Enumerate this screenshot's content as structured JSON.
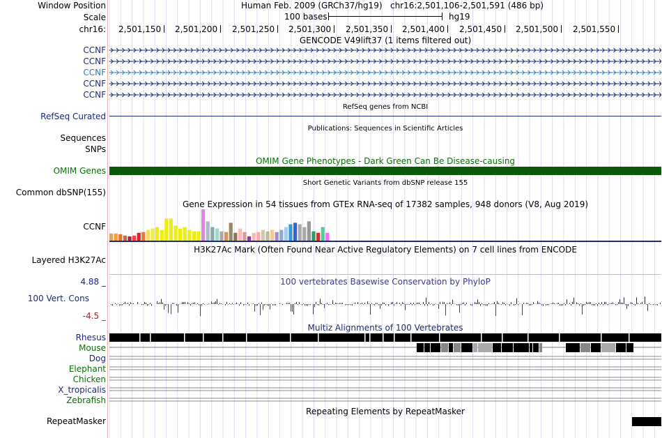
{
  "header": {
    "window_position_label": "Window Position",
    "assembly": "Human Feb. 2009 (GRCh37/hg19)",
    "position": "chr16:2,501,106-2,501,591 (486 bp)",
    "scale_label": "Scale",
    "scale_text": "100 bases",
    "db": "hg19",
    "chrom_label": "chr16:",
    "ticks": [
      "2,501,150",
      "2,501,200",
      "2,501,250",
      "2,501,300",
      "2,501,350",
      "2,501,400",
      "2,501,450",
      "2,501,500",
      "2,501,550"
    ]
  },
  "tracks": {
    "gencode": {
      "title": "GENCODE V49lift37 (1 items filtered out)",
      "genes": [
        "CCNF",
        "CCNF",
        "CCNF",
        "CCNF",
        "CCNF"
      ],
      "colors": {
        "main": "#1c2a78",
        "highlight": "#2a7fb5"
      }
    },
    "refseq": {
      "label": "RefSeq Curated",
      "title": "RefSeq genes from NCBI"
    },
    "publications": {
      "title": "Publications: Sequences in Scientific Articles",
      "label_sequences": "Sequences",
      "label_snps": "SNPs"
    },
    "omim": {
      "title": "OMIM Gene Phenotypes - Dark Green Can Be Disease-causing",
      "label": "OMIM Genes",
      "color": "#0a5a0a"
    },
    "dbsnp": {
      "title": "Short Genetic Variants from dbSNP release 155",
      "label": "Common dbSNP(155)"
    },
    "gtex": {
      "title": "Gene Expression in 54 tissues from GTEx RNA-seq of 17382 samples, 948 donors (V8, Aug 2019)",
      "label": "CCNF",
      "bars": [
        {
          "v": 10,
          "c": "#f0a050"
        },
        {
          "v": 10,
          "c": "#ff9933"
        },
        {
          "v": 9,
          "c": "#d97a3a"
        },
        {
          "v": 7,
          "c": "#cc6644"
        },
        {
          "v": 6,
          "c": "#aa2244"
        },
        {
          "v": 7,
          "c": "#ee4455"
        },
        {
          "v": 11,
          "c": "#dd2222"
        },
        {
          "v": 12,
          "c": "#ee7733"
        },
        {
          "v": 15,
          "c": "#eedd66"
        },
        {
          "v": 17,
          "c": "#eeee44"
        },
        {
          "v": 19,
          "c": "#eeee11"
        },
        {
          "v": 15,
          "c": "#eeee11"
        },
        {
          "v": 31,
          "c": "#eeee11"
        },
        {
          "v": 31,
          "c": "#eeee11"
        },
        {
          "v": 21,
          "c": "#eeee11"
        },
        {
          "v": 17,
          "c": "#eeee11"
        },
        {
          "v": 19,
          "c": "#eeee11"
        },
        {
          "v": 15,
          "c": "#eeee11"
        },
        {
          "v": 13,
          "c": "#eeee11"
        },
        {
          "v": 13,
          "c": "#eeee11"
        },
        {
          "v": 44,
          "c": "#dd88dd"
        },
        {
          "v": 27,
          "c": "#aabbcc"
        },
        {
          "v": 19,
          "c": "#88aaaa"
        },
        {
          "v": 17,
          "c": "#99ddcc"
        },
        {
          "v": 13,
          "c": "#aaaaaa"
        },
        {
          "v": 12,
          "c": "#cc9966"
        },
        {
          "v": 25,
          "c": "#998866"
        },
        {
          "v": 11,
          "c": "#887755"
        },
        {
          "v": 17,
          "c": "#ffbbbb"
        },
        {
          "v": 12,
          "c": "#dd9999"
        },
        {
          "v": 6,
          "c": "#993399"
        },
        {
          "v": 11,
          "c": "#eebbbb"
        },
        {
          "v": 12,
          "c": "#ffaaaa"
        },
        {
          "v": 15,
          "c": "#ccccaa"
        },
        {
          "v": 13,
          "c": "#bbbb99"
        },
        {
          "v": 15,
          "c": "#eecc99"
        },
        {
          "v": 12,
          "c": "#aa88cc"
        },
        {
          "v": 15,
          "c": "#88aadd"
        },
        {
          "v": 19,
          "c": "#aaccee"
        },
        {
          "v": 23,
          "c": "#3399dd"
        },
        {
          "v": 25,
          "c": "#3366cc"
        },
        {
          "v": 23,
          "c": "#aaaaaa"
        },
        {
          "v": 19,
          "c": "#aaaaaa"
        },
        {
          "v": 27,
          "c": "#999999"
        },
        {
          "v": 13,
          "c": "#339966"
        },
        {
          "v": 11,
          "c": "#cc3333"
        },
        {
          "v": 19,
          "c": "#55cc99"
        },
        {
          "v": 11,
          "c": "#ff66ff"
        }
      ]
    },
    "h3k27ac": {
      "title": "H3K27Ac Mark (Often Found Near Active Regulatory Elements) on 7 cell lines from ENCODE",
      "label": "Layered H3K27Ac"
    },
    "conservation": {
      "title": "100 vertebrates Basewise Conservation by PhyloP",
      "label": "100 Vert. Cons",
      "max_label": "4.88 _",
      "min_label": "-4.5 _",
      "range": [
        -4.5,
        4.88
      ]
    },
    "multiz": {
      "title": "Multiz Alignments of 100 Vertebrates",
      "species": [
        {
          "name": "Rhesus",
          "color": "#1c2a78"
        },
        {
          "name": "Mouse",
          "color": "#0b6e0b"
        },
        {
          "name": "Dog",
          "color": "#1c2a78"
        },
        {
          "name": "Elephant",
          "color": "#0b6e0b"
        },
        {
          "name": "Chicken",
          "color": "#0b6e0b"
        },
        {
          "name": "X_tropicalis",
          "color": "#1c2a78"
        },
        {
          "name": "Zebrafish",
          "color": "#0b6e0b"
        }
      ]
    },
    "repeatmasker": {
      "title": "Repeating Elements by RepeatMasker",
      "label": "RepeatMasker"
    }
  }
}
